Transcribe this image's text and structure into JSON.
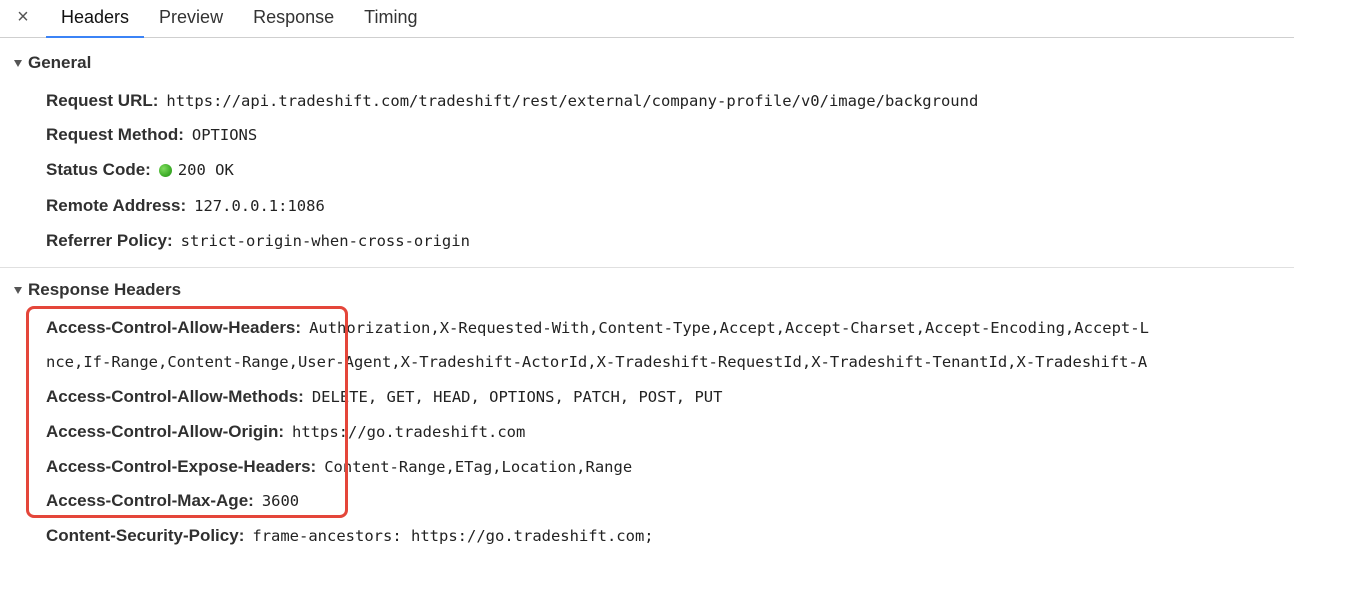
{
  "tabs": {
    "close_label": "×",
    "items": [
      {
        "label": "Headers",
        "active": true
      },
      {
        "label": "Preview",
        "active": false
      },
      {
        "label": "Response",
        "active": false
      },
      {
        "label": "Timing",
        "active": false
      }
    ]
  },
  "general": {
    "title": "General",
    "rows": [
      {
        "key": "Request URL:",
        "value": "https://api.tradeshift.com/tradeshift/rest/external/company-profile/v0/image/background"
      },
      {
        "key": "Request Method:",
        "value": "OPTIONS"
      },
      {
        "key": "Status Code:",
        "value": "200 OK",
        "status_color": "#3fae2a"
      },
      {
        "key": "Remote Address:",
        "value": "127.0.0.1:1086"
      },
      {
        "key": "Referrer Policy:",
        "value": "strict-origin-when-cross-origin"
      }
    ]
  },
  "response_headers": {
    "title": "Response Headers",
    "rows": [
      {
        "key": "Access-Control-Allow-Headers:",
        "value": "Authorization,X-Requested-With,Content-Type,Accept,Accept-Charset,Accept-Encoding,Accept-L",
        "continuation": "nce,If-Range,Content-Range,User-Agent,X-Tradeshift-ActorId,X-Tradeshift-RequestId,X-Tradeshift-TenantId,X-Tradeshift-A"
      },
      {
        "key": "Access-Control-Allow-Methods:",
        "value": "DELETE, GET, HEAD, OPTIONS, PATCH, POST, PUT"
      },
      {
        "key": "Access-Control-Allow-Origin:",
        "value": "https://go.tradeshift.com"
      },
      {
        "key": "Access-Control-Expose-Headers:",
        "value": "Content-Range,ETag,Location,Range"
      },
      {
        "key": "Access-Control-Max-Age:",
        "value": "3600"
      },
      {
        "key": "Content-Security-Policy:",
        "value": "frame-ancestors: https://go.tradeshift.com;"
      }
    ]
  },
  "colors": {
    "highlight": "#e4463a",
    "active_tab": "#3b83f6"
  }
}
